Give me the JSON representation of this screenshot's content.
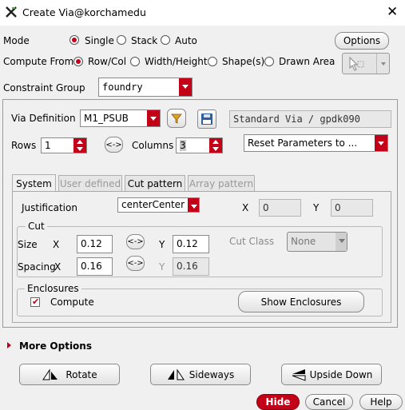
{
  "window": {
    "title": "Create Via@korchamedu",
    "close_glyph": "✕"
  },
  "mode": {
    "label": "Mode",
    "options": [
      "Single",
      "Stack",
      "Auto"
    ],
    "selected": "Single",
    "options_button": "Options"
  },
  "compute_from": {
    "label": "Compute From",
    "options": [
      "Row/Col",
      "Width/Height",
      "Shape(s)",
      "Drawn Area"
    ],
    "selected": "Row/Col"
  },
  "constraint_group": {
    "label": "Constraint Group",
    "value": "foundry"
  },
  "via_definition": {
    "label": "Via Definition",
    "value": "M1_PSUB",
    "description": "Standard Via / gpdk090"
  },
  "rows": {
    "label": "Rows",
    "value": "1"
  },
  "columns": {
    "label": "Columns",
    "value": "3"
  },
  "swap_label": "<->",
  "reset_params": {
    "value": "Reset Parameters to ..."
  },
  "tabs": [
    {
      "label": "System",
      "state": "active"
    },
    {
      "label": "User defined",
      "state": "disabled"
    },
    {
      "label": "Cut pattern",
      "state": "enabled"
    },
    {
      "label": "Array pattern",
      "state": "disabled"
    }
  ],
  "justification": {
    "label": "Justification",
    "value": "centerCenter",
    "x_label": "X",
    "x_value": "0",
    "y_label": "Y",
    "y_value": "0"
  },
  "cut": {
    "title": "Cut",
    "size_label": "Size",
    "x_label": "X",
    "y_label": "Y",
    "size_x": "0.12",
    "size_y": "0.12",
    "cut_class_label": "Cut Class",
    "cut_class_value": "None",
    "spacing_label": "Spacing",
    "spacing_x": "0.16",
    "spacing_y": "0.16"
  },
  "enclosures": {
    "title": "Enclosures",
    "compute_label": "Compute",
    "compute_checked": true,
    "show_button": "Show Enclosures"
  },
  "more_options": {
    "label": "More Options"
  },
  "transform_buttons": {
    "rotate": "Rotate",
    "sideways": "Sideways",
    "upside_down": "Upside Down"
  },
  "footer": {
    "hide": "Hide",
    "cancel": "Cancel",
    "help": "Help"
  },
  "colors": {
    "accent": "#c40019",
    "filter_icon": "#e0a020",
    "save_icon": "#2e5f9a"
  }
}
